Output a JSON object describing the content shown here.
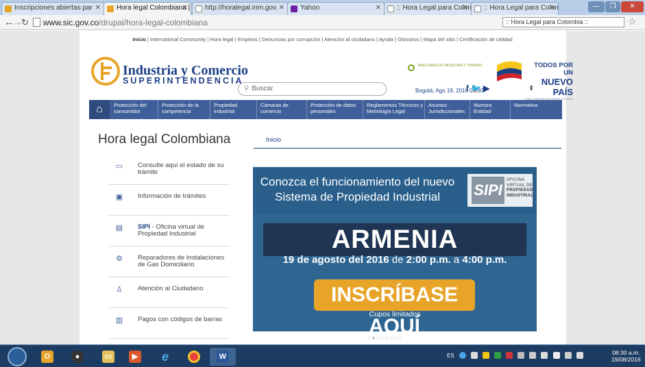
{
  "browser": {
    "tabs": [
      {
        "label": "Inscripciones abiertas par",
        "active": false
      },
      {
        "label": "Hora legal Colombiana |",
        "active": true
      },
      {
        "label": "http://horalegal.inm.gov.",
        "active": false
      },
      {
        "label": "Yahoo",
        "active": false
      },
      {
        "label": ":: Hora Legal para Colom",
        "active": false
      },
      {
        "label": ":: Hora Legal para Colom",
        "active": false
      }
    ],
    "url_host": "www.sic.gov.co",
    "url_path": "/drupal/hora-legal-colombiana",
    "extension_box": ":: Hora Legal para Colombia ::"
  },
  "site": {
    "top_menu": {
      "first": "Inicio",
      "rest": " | International Community | Hora legal | Empleos | Denuncias por corrupción | Atención al ciudadano | Ayuda | Glosarios | Mapa del sitio | Certificación de calidad"
    },
    "brand_title": "Industria y Comercio",
    "brand_subtitle": "SUPERINTENDENCIA",
    "search_placeholder": "Buscar",
    "date_text": "Bogotá, Ago 19, 2016 08:30",
    "mincit_text": "MINCOMERCIO INDUSTRIA Y TURISMO",
    "slogan": {
      "line1": "TODOS POR UN",
      "line2": "NUEVO PAÍS",
      "line3": "PAZ EQUIDAD EDUCACIÓN"
    },
    "nav": [
      "Protección del consumidor",
      "Protección de la competencia",
      "Propiedad industrial",
      "Cámaras de comercio",
      "Protección de datos personales",
      "Reglamentos Técnicos y Metrología Legal",
      "Asuntos Jurisdiccionales",
      "Nuestra Entidad",
      "Normativa"
    ],
    "page_title": "Hora legal Colombiana",
    "breadcrumb": "Inicio",
    "sidebar": [
      {
        "icon": "id-card-icon",
        "label": "Consulte aquí el estado de su trámite"
      },
      {
        "icon": "monitor-icon",
        "label": "Información de trámites"
      },
      {
        "icon": "sipi-icon",
        "label_bold": "SIPI",
        "label": " - Oficina virtual de Propiedad Industrial"
      },
      {
        "icon": "gears-icon",
        "label": "Reparadores de Instalaciones de Gas Domiciliario"
      },
      {
        "icon": "person-icon",
        "label": "Atención al Ciudadano"
      },
      {
        "icon": "barcode-icon",
        "label": "Pagos con códigos de barras"
      }
    ],
    "banner": {
      "line1": "Conozca el funcionamiento del nuevo",
      "line2": "Sistema de Propiedad Industrial",
      "sipi_logo": "SIPI",
      "sipi_text": [
        "OFICINA",
        "VIRTUAL DE",
        "PROPIEDAD",
        "INDUSTRIAL"
      ],
      "city": "ARMENIA",
      "date_pre": "19 de agosto del 2016",
      "date_mid": " de ",
      "date_start": "2:00 p.m.",
      "date_a": " a ",
      "date_end": "4:00 p.m.",
      "cta": "INSCRÍBASE AQUÍ",
      "note": "Cupos limitados"
    }
  },
  "taskbar": {
    "language": "ES",
    "time": "08:30 a.m.",
    "date": "19/08/2016"
  }
}
